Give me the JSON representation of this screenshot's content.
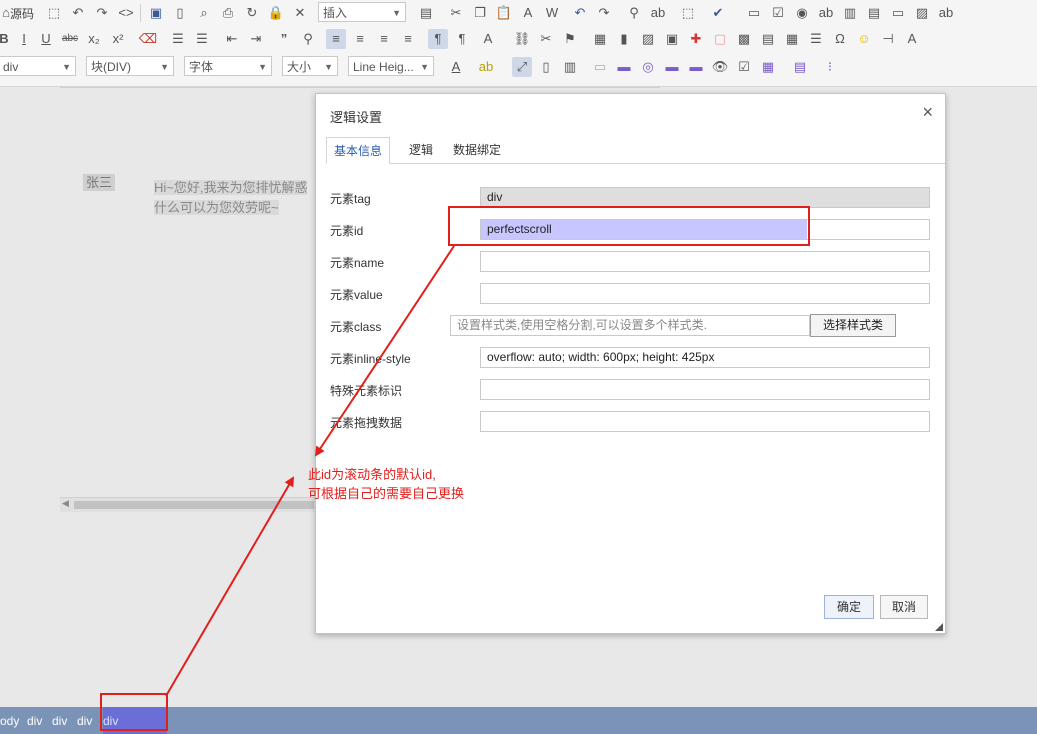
{
  "toolbar": {
    "source_label": "源码",
    "insert_label": "插入",
    "block_format": "div",
    "block_type": "块(DIV)",
    "font_family": "字体",
    "font_size": "大小",
    "line_height": "Line Heig..."
  },
  "editor": {
    "name_tag": "张三",
    "message_line1": "Hi~您好,我来为您排忧解惑",
    "message_line2": "什么可以为您效劳呢~"
  },
  "statusbar": {
    "crumbs": [
      "ody",
      "div",
      "div",
      "div",
      "div"
    ]
  },
  "dialog": {
    "title": "逻辑设置",
    "close_symbol": "×",
    "tabs": [
      "基本信息",
      "逻辑",
      "数据绑定"
    ],
    "fields": {
      "tag_label": "元素tag",
      "tag_value": "div",
      "id_label": "元素id",
      "id_value": "perfectscroll",
      "name_label": "元素name",
      "name_value": "",
      "value_label": "元素value",
      "value_value": "",
      "class_label": "元素class",
      "class_placeholder": "设置样式类,使用空格分割,可以设置多个样式类.",
      "class_button": "选择样式类",
      "style_label": "元素inline-style",
      "style_value": "overflow: auto; width: 600px; height: 425px",
      "special_label": "特殊元素标识",
      "special_value": "",
      "drag_label": "元素拖拽数据",
      "drag_value": ""
    },
    "ok_label": "确定",
    "cancel_label": "取消"
  },
  "annotation": {
    "line1": "此id为滚动条的默认id,",
    "line2": "可根据自己的需要自己更换",
    "color": "#e0201c"
  },
  "colors": {
    "statusbar": "#7b93b7",
    "selection": "#c8c6ff",
    "accent": "#2a5db0"
  }
}
